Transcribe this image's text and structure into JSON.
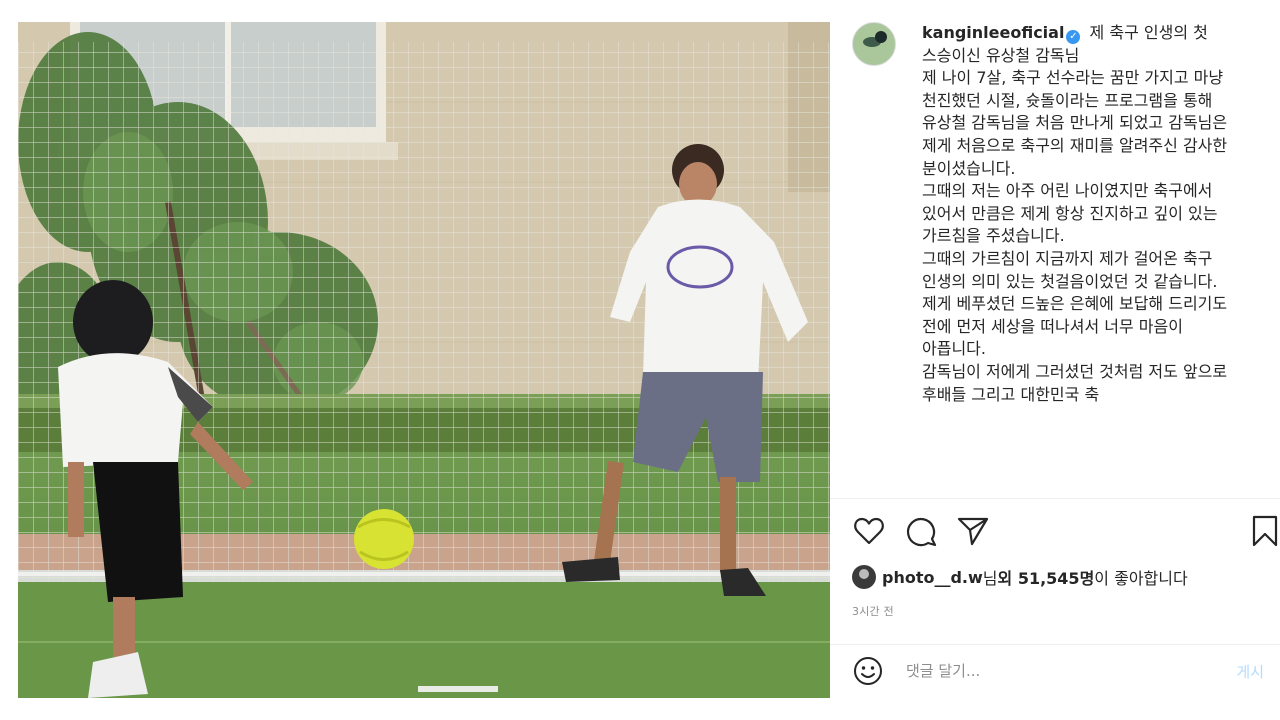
{
  "post": {
    "username": "kanginleeoficial",
    "caption_lines": [
      "제 축구 인생의 첫 스승이신 유상철 감독님",
      "제 나이 7살, 축구 선수라는 꿈만 가지고 마냥 천진했던 시절, 슛돌이라는 프로그램을 통해 유상철 감독님을 처음 만나게 되었고 감독님은 제게 처음으로 축구의 재미를 알려주신 감사한 분이셨습니다.",
      "그때의 저는 아주 어린 나이였지만 축구에서 있어서 만큼은 제게 항상 진지하고 깊이 있는 가르침을 주셨습니다.",
      "그때의 가르침이 지금까지 제가 걸어온 축구 인생의 의미 있는 첫걸음이었던 것 같습니다.",
      "제게 베푸셨던 드높은 은혜에 보답해 드리기도 전에 먼저 세상을 떠나셔서 너무 마음이 아픕니다.",
      "감독님이 저에게 그러셨던 것처럼 저도 앞으로 후배들 그리고 대한민국 축"
    ],
    "likes": {
      "user": "photo__d.w",
      "suffix_1": "님 ",
      "others": "외 51,545명",
      "suffix_2": "이 좋아합니다"
    },
    "time": "3시간 전",
    "comment_placeholder": "댓글 달기...",
    "post_button": "게시"
  },
  "icons": {
    "like": "heart-icon",
    "comment": "comment-icon",
    "share": "paper-plane-icon",
    "save": "bookmark-icon",
    "emoji": "emoji-icon",
    "verified": "verified-badge-icon"
  },
  "colors": {
    "verified": "#3897f0",
    "post_button": "#b3dbff",
    "muted": "#8e8e8e"
  }
}
